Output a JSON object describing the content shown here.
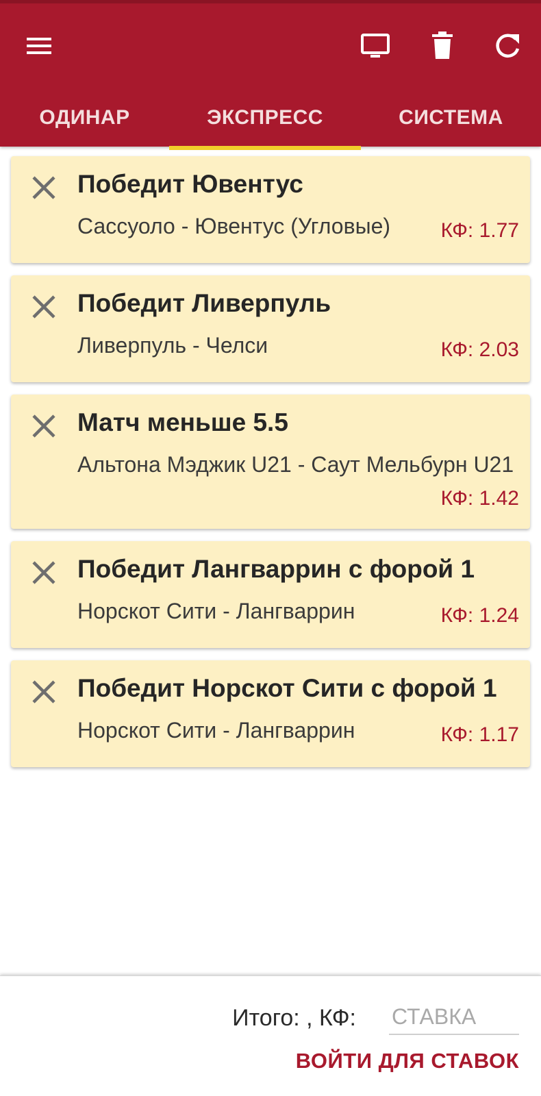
{
  "header": {
    "icons": [
      "menu-icon",
      "monitor-icon",
      "trash-icon",
      "refresh-icon"
    ],
    "background_color": "#a8192d"
  },
  "tabs": [
    {
      "label": "ОДИНАР",
      "active": false
    },
    {
      "label": "ЭКСПРЕСС",
      "active": true
    },
    {
      "label": "СИСТЕМА",
      "active": false
    }
  ],
  "bets": [
    {
      "title": "Победит Ювентус",
      "match": "Сассуоло - Ювентус (Угловые)",
      "odds": "КФ: 1.77"
    },
    {
      "title": "Победит Ливерпуль",
      "match": "Ливерпуль - Челси",
      "odds": "КФ: 2.03"
    },
    {
      "title": "Матч меньше 5.5",
      "match": "Альтона Мэджик U21 - Саут Мельбурн U21",
      "odds": "КФ: 1.42"
    },
    {
      "title": "Победит Лангваррин с форой 1",
      "match": "Норскот Сити - Лангваррин",
      "odds": "КФ: 1.24"
    },
    {
      "title": "Победит Норскот Сити с форой 1",
      "match": "Норскот Сити - Лангваррин",
      "odds": "КФ: 1.17"
    }
  ],
  "footer": {
    "total_label": "Итого: , КФ:",
    "stake_placeholder": "СТАВКА",
    "login_label": "ВОЙТИ ДЛЯ СТАВОК"
  },
  "colors": {
    "accent": "#a8192d",
    "tab_indicator": "#f1cf2a",
    "card_background": "#fdf0c4"
  }
}
